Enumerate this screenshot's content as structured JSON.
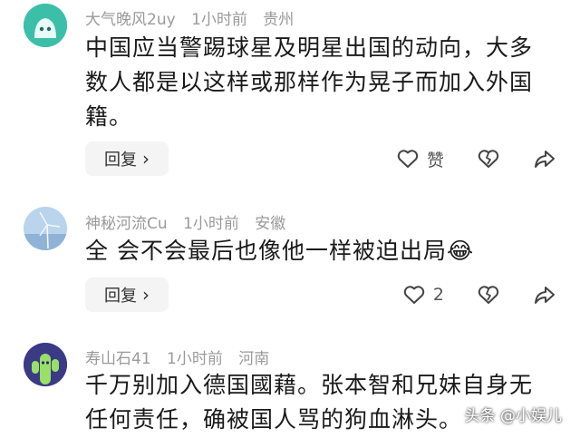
{
  "comments": [
    {
      "username": "大气晚风2uy",
      "time": "1小时前",
      "location": "贵州",
      "text_line1": "中国应当警踢球星及明星出国的动向，大多",
      "text_line2": "数人都是以这样或那样作为晃子而加入外国",
      "text_line3": "籍。",
      "reply_label": "回复",
      "like_label": "赞"
    },
    {
      "username": "神秘河流Cu",
      "time": "1小时前",
      "location": "安徽",
      "text_line1": "全 会不会最后也像他一样被迫出局",
      "emoji": "😂",
      "reply_label": "回复",
      "like_count": "2"
    },
    {
      "username": "寿山石41",
      "time": "1小时前",
      "location": "河南",
      "text_line1": "千万别加入德国國藉。张本智和兄妹自身无",
      "text_line2": "任何责任，确被国人骂的狗血淋头。"
    }
  ],
  "watermark": "头条 @小娱儿",
  "icons": [
    "heart-icon",
    "broken-heart-icon",
    "share-icon",
    "chevron-right-icon"
  ]
}
